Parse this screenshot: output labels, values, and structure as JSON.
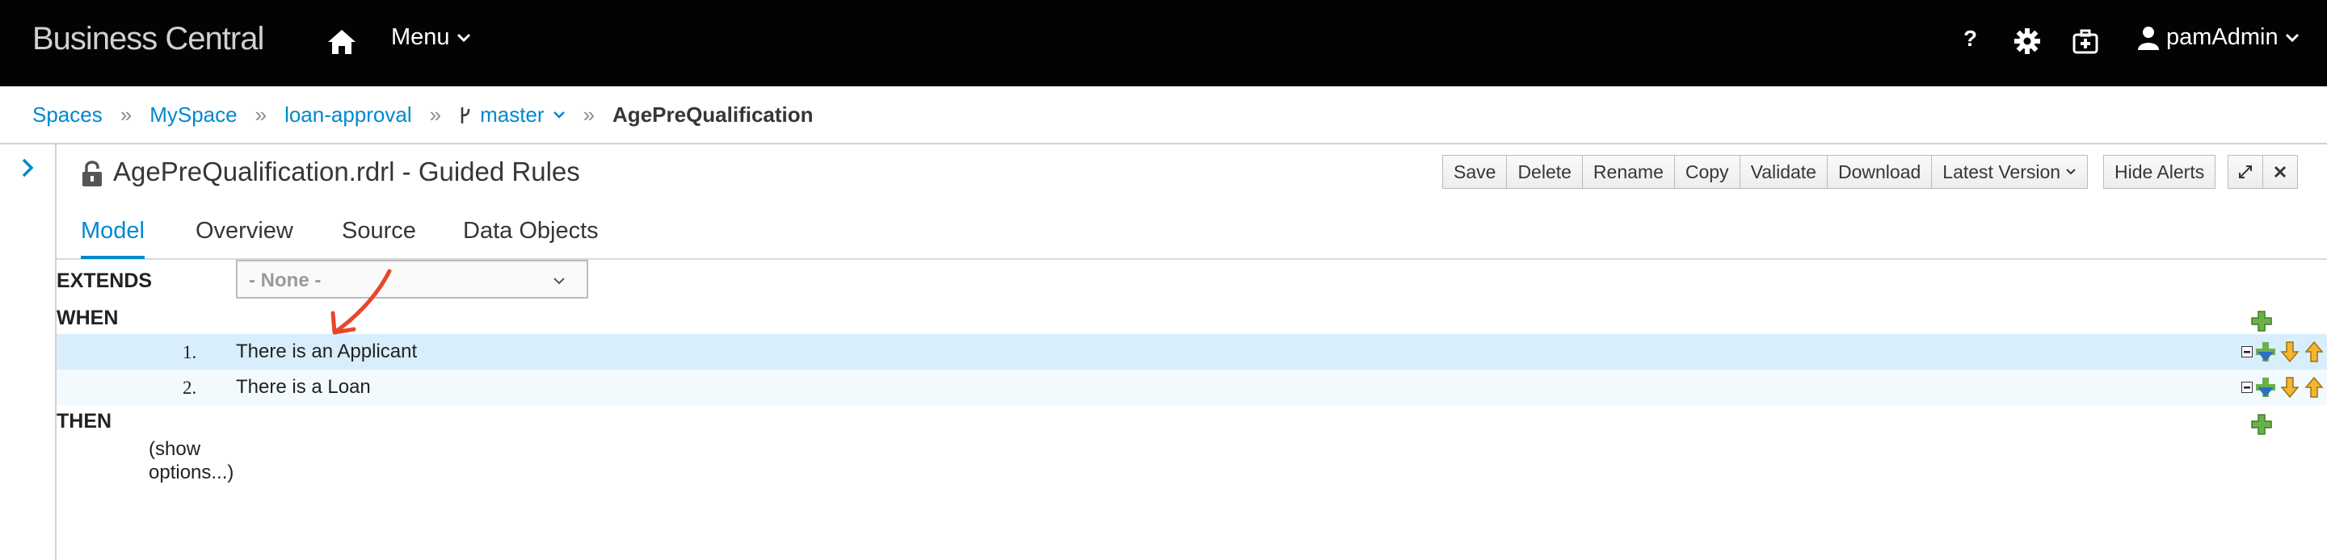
{
  "app": {
    "brand": "Business Central"
  },
  "navbar": {
    "menu_label": "Menu",
    "help_label": "?",
    "user_name": "pamAdmin"
  },
  "breadcrumb": {
    "items": [
      "Spaces",
      "MySpace",
      "loan-approval"
    ],
    "branch": "master",
    "current": "AgePreQualification",
    "separator": "»"
  },
  "editor": {
    "title": "AgePreQualification.rdrl - Guided Rules",
    "toolbar": {
      "save": "Save",
      "delete": "Delete",
      "rename": "Rename",
      "copy": "Copy",
      "validate": "Validate",
      "download": "Download",
      "latest_version": "Latest Version",
      "hide_alerts": "Hide Alerts"
    },
    "tabs": [
      "Model",
      "Overview",
      "Source",
      "Data Objects"
    ],
    "active_tab": "Model"
  },
  "rule": {
    "extends_label": "EXTENDS",
    "extends_value": "- None -",
    "when_label": "WHEN",
    "conditions": [
      {
        "num": "1.",
        "text": "There is an Applicant"
      },
      {
        "num": "2.",
        "text": "There is a Loan"
      }
    ],
    "then_label": "THEN",
    "show_options": "(show options...)"
  },
  "colors": {
    "navbar_bg": "#030303",
    "link": "#0088ce",
    "row_selected": "#d8eefc",
    "row_alt": "#f2fafe",
    "annotation_arrow": "#e8472b"
  }
}
